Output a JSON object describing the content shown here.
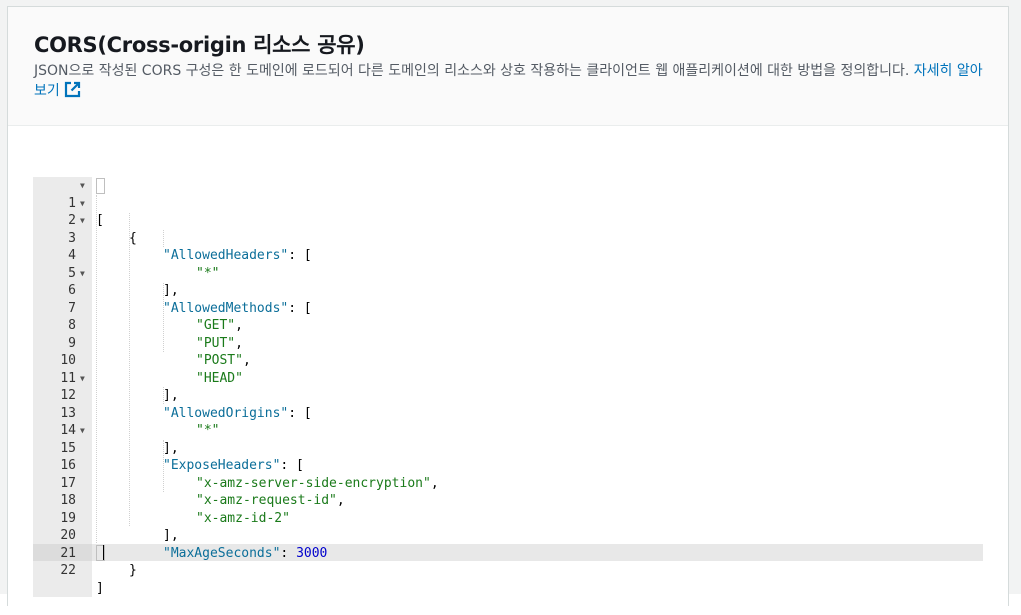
{
  "header": {
    "title": "CORS(Cross-origin 리소스 공유)",
    "description": "JSON으로 작성된 CORS 구성은 한 도메인에 로드되어 다른 도메인의 리소스와 상호 작용하는 클라이언트 웹 애플리케이션에 대한 방법을 정의합니다.",
    "learn_more": "자세히 알아보기",
    "learn_more_icon": "external-link-icon",
    "link_color": "#0073bb"
  },
  "editor": {
    "active_line": 22,
    "lines": [
      {
        "num": "1",
        "fold": true
      },
      {
        "num": "2",
        "fold": true
      },
      {
        "num": "3",
        "fold": true
      },
      {
        "num": "4",
        "fold": false
      },
      {
        "num": "5",
        "fold": false
      },
      {
        "num": "6",
        "fold": true
      },
      {
        "num": "7",
        "fold": false
      },
      {
        "num": "8",
        "fold": false
      },
      {
        "num": "9",
        "fold": false
      },
      {
        "num": "10",
        "fold": false
      },
      {
        "num": "11",
        "fold": false
      },
      {
        "num": "12",
        "fold": true
      },
      {
        "num": "13",
        "fold": false
      },
      {
        "num": "14",
        "fold": false
      },
      {
        "num": "15",
        "fold": true
      },
      {
        "num": "16",
        "fold": false
      },
      {
        "num": "17",
        "fold": false
      },
      {
        "num": "18",
        "fold": false
      },
      {
        "num": "19",
        "fold": false
      },
      {
        "num": "20",
        "fold": false
      },
      {
        "num": "21",
        "fold": false
      },
      {
        "num": "22",
        "fold": false
      }
    ],
    "tokens": {
      "l1": "[",
      "l2": "{",
      "l3_key": "\"AllowedHeaders\"",
      "l3_rest": ": [",
      "l4": "\"*\"",
      "l5": "],",
      "l6_key": "\"AllowedMethods\"",
      "l6_rest": ": [",
      "l7": "\"GET\"",
      "l8": "\"PUT\"",
      "l9": "\"POST\"",
      "l10": "\"HEAD\"",
      "l11": "],",
      "l12_key": "\"AllowedOrigins\"",
      "l12_rest": ": [",
      "l13": "\"*\"",
      "l14": "],",
      "l15_key": "\"ExposeHeaders\"",
      "l15_rest": ": [",
      "l16": "\"x-amz-server-side-encryption\"",
      "l17": "\"x-amz-request-id\"",
      "l18": "\"x-amz-id-2\"",
      "l19": "],",
      "l20_key": "\"MaxAgeSeconds\"",
      "l20_sep": ": ",
      "l20_val": "3000",
      "l21": "}",
      "l22": "]",
      "comma": ","
    }
  }
}
